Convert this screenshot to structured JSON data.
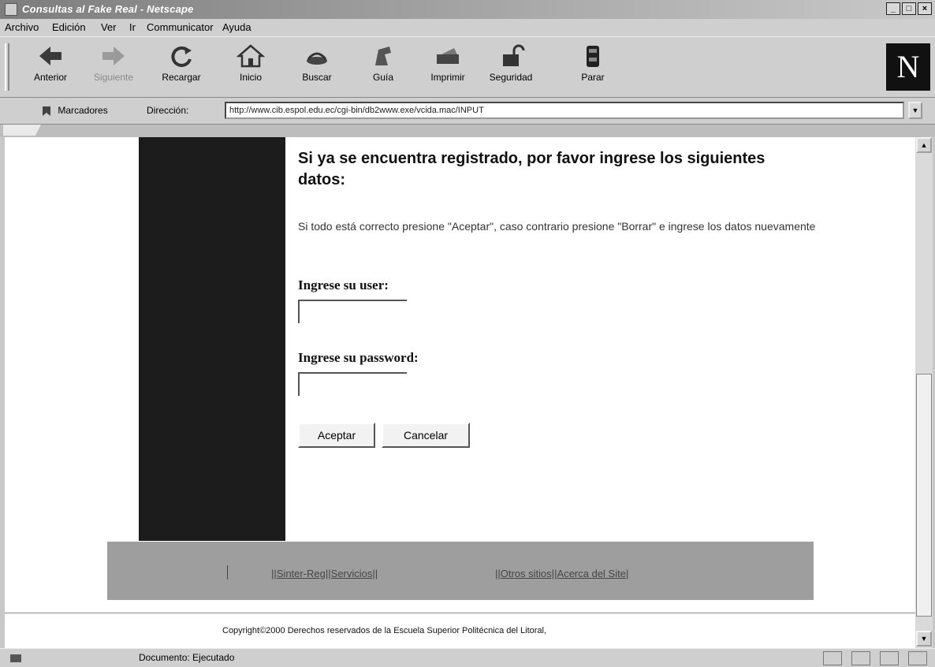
{
  "window": {
    "title": "Consultas al Fake Real - Netscape"
  },
  "menu": [
    "Archivo",
    "Edición",
    "Ver",
    "Ir",
    "Communicator",
    "Ayuda"
  ],
  "toolbar": {
    "buttons": [
      {
        "label": "Anterior",
        "icon": "back-arrow-icon",
        "enabled": true
      },
      {
        "label": "Siguiente",
        "icon": "forward-arrow-icon",
        "enabled": false
      },
      {
        "label": "Recargar",
        "icon": "reload-icon",
        "enabled": true
      },
      {
        "label": "Inicio",
        "icon": "home-icon",
        "enabled": true
      },
      {
        "label": "Buscar",
        "icon": "search-icon",
        "enabled": true
      },
      {
        "label": "Guía",
        "icon": "guide-icon",
        "enabled": true
      },
      {
        "label": "Imprimir",
        "icon": "print-icon",
        "enabled": true
      },
      {
        "label": "Seguridad",
        "icon": "security-lock-icon",
        "enabled": true
      },
      {
        "label": "Parar",
        "icon": "stop-icon",
        "enabled": true
      }
    ],
    "logo": "N"
  },
  "location": {
    "bookmarks_label": "Marcadores",
    "address_label": "Dirección:",
    "url": "http://www.cib.espol.edu.ec/cgi-bin/db2www.exe/vcida.mac/INPUT"
  },
  "page": {
    "heading": "Si ya se encuentra registrado, por favor ingrese los siguientes datos:",
    "instructions": "Si todo está correcto presione \"Aceptar\", caso contrario presione \"Borrar\" e ingrese los datos nuevamente",
    "user_label": "Ingrese su user:",
    "password_label": "Ingrese su password:",
    "user_value": "",
    "password_value": "",
    "accept_button": "Aceptar",
    "cancel_button": "Cancelar",
    "footer_links_left": "||Sinter-Reg||Servicios||",
    "footer_links_right": "||Otros sitios||Acerca del Site|",
    "copyright": "Copyright©2000 Derechos reservados de la Escuela Superior Politécnica del Litoral,"
  },
  "status": {
    "text": "Documento: Ejecutado"
  },
  "colors": {
    "sidebar": "#1c1c1c",
    "footer_band": "#9e9e9e",
    "chrome": "#cfcfcf"
  }
}
